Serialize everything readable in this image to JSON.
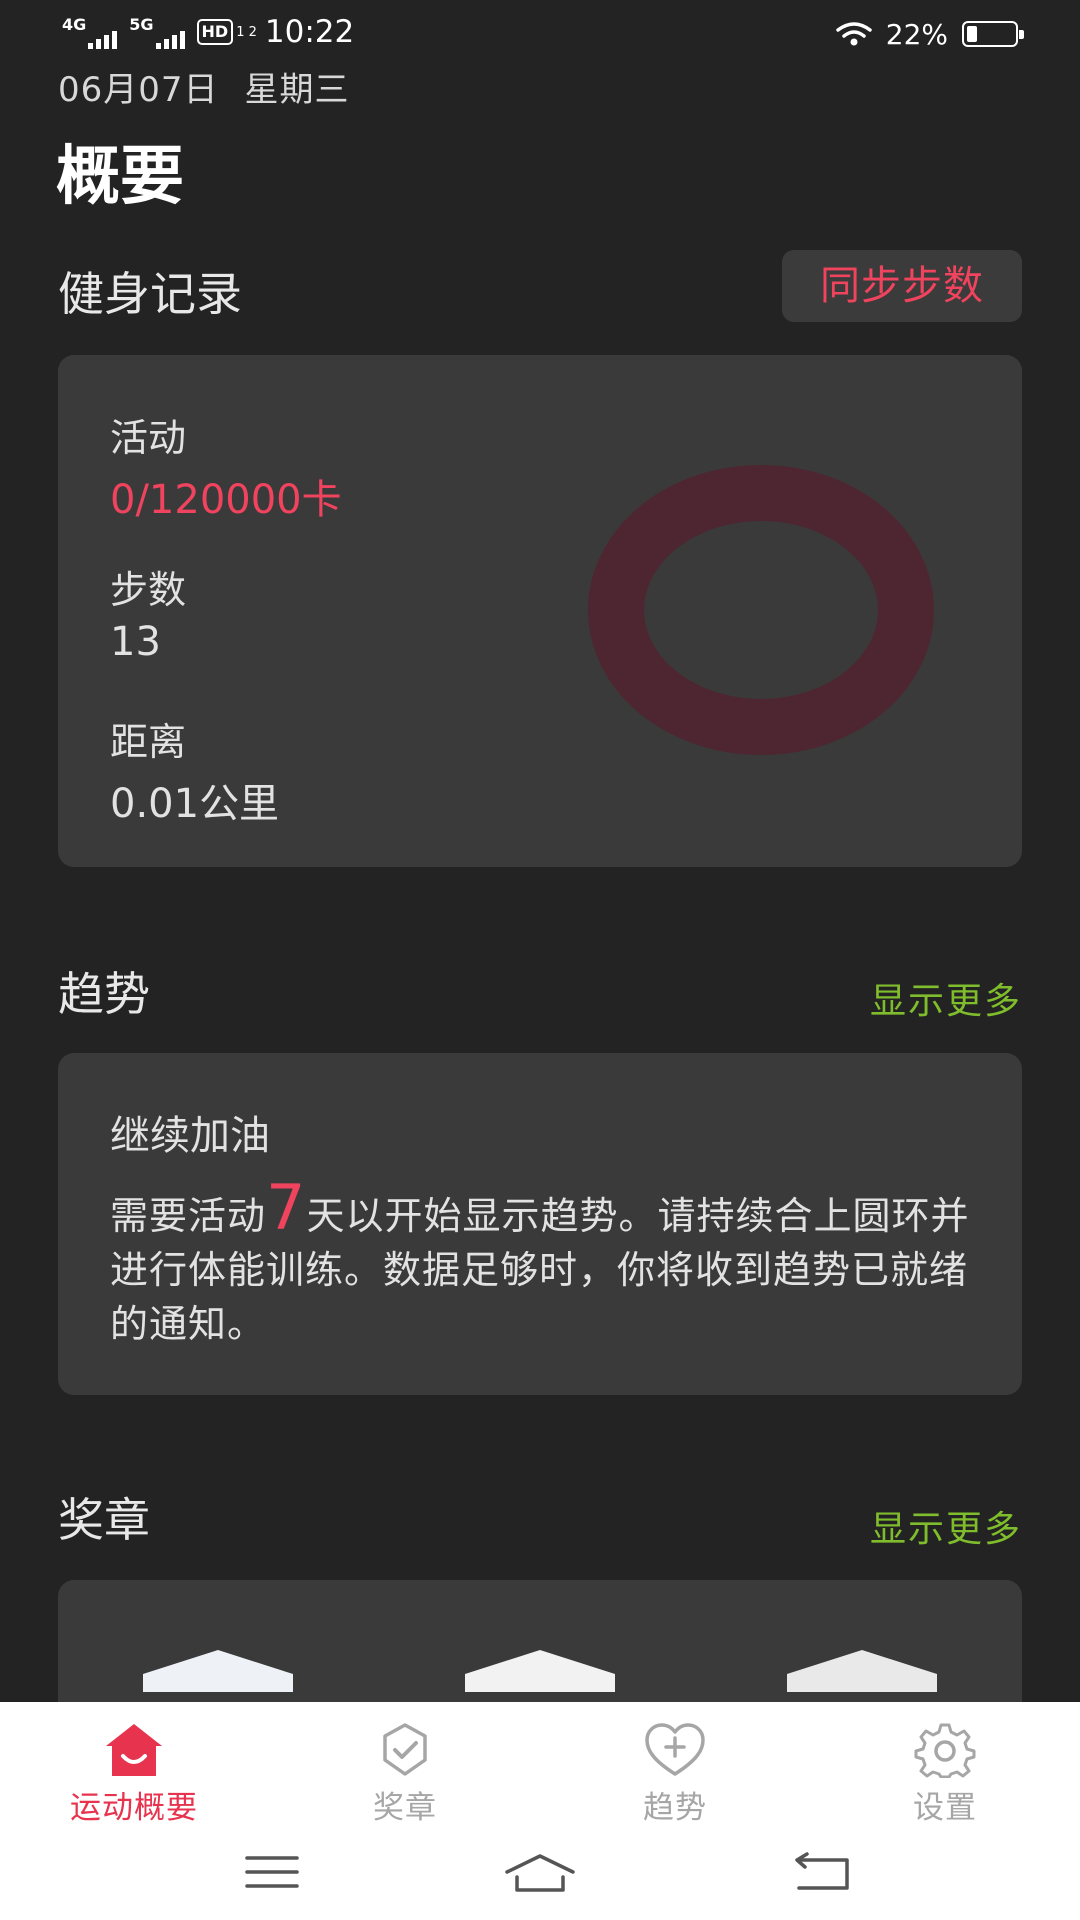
{
  "status_bar": {
    "network_1": "4G",
    "network_2": "5G",
    "hd": "HD",
    "hd_sub": "1 2",
    "time": "10:22",
    "battery": "22%",
    "battery_level": 0.22
  },
  "header": {
    "date": "06月07日",
    "weekday": "星期三",
    "title": "概要"
  },
  "fitness": {
    "section_title": "健身记录",
    "sync_label": "同步步数",
    "activity_label": "活动",
    "activity_value": "0/120000卡",
    "steps_label": "步数",
    "steps_value": "13",
    "distance_label": "距离",
    "distance_value": "0.01公里",
    "ring_progress": 0
  },
  "trends": {
    "section_title": "趋势",
    "show_more": "显示更多",
    "card_title": "继续加油",
    "message_before": "需要活动",
    "message_number": "7",
    "message_after": "天以开始显示趋势。请持续合上圆环并进行体能训练。数据足够时，你将收到趋势已就绪的通知。"
  },
  "medals": {
    "section_title": "奖章",
    "show_more": "显示更多"
  },
  "bottom_nav": {
    "items": [
      {
        "label": "运动概要",
        "icon": "home-icon",
        "active": true
      },
      {
        "label": "奖章",
        "icon": "medal-icon",
        "active": false
      },
      {
        "label": "趋势",
        "icon": "heart-plus-icon",
        "active": false
      },
      {
        "label": "设置",
        "icon": "gear-icon",
        "active": false
      }
    ]
  },
  "system_nav": [
    "menu-icon",
    "home-outline-icon",
    "back-icon"
  ],
  "colors": {
    "background": "#232323",
    "card": "#3a3a3a",
    "accent_red": "#f0435e",
    "accent_green": "#7fbd2c",
    "ring": "#4d2631"
  }
}
